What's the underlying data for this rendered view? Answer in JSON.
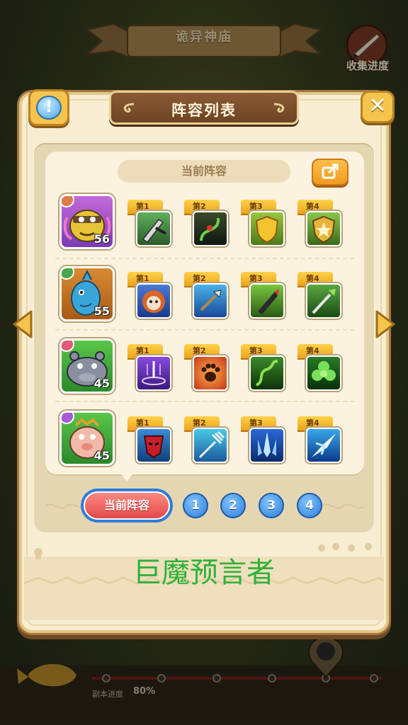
{
  "background": {
    "banner_title": "诡异神庙",
    "collection_label": "收集进度",
    "dungeon_progress_label": "副本进度",
    "dungeon_progress_value": "80%"
  },
  "dialog": {
    "title": "阵容列表",
    "current_lineup_label": "当前阵容",
    "info_symbol": "!",
    "close_symbol": "✕"
  },
  "lineup": {
    "rows": [
      {
        "hero_icon": "yellow-purple-hero-portrait",
        "level": "56",
        "slots": [
          {
            "tag": "第1",
            "icon": "blade-skill-icon"
          },
          {
            "tag": "第2",
            "icon": "dark-vine-skill-icon"
          },
          {
            "tag": "第3",
            "icon": "gold-shield-skill-icon"
          },
          {
            "tag": "第4",
            "icon": "star-shield-skill-icon"
          }
        ]
      },
      {
        "hero_icon": "blue-fish-hero-portrait",
        "level": "55",
        "slots": [
          {
            "tag": "第1",
            "icon": "lion-skill-icon"
          },
          {
            "tag": "第2",
            "icon": "spear-skill-icon"
          },
          {
            "tag": "第3",
            "icon": "drill-skill-icon"
          },
          {
            "tag": "第4",
            "icon": "green-spear-skill-icon"
          }
        ]
      },
      {
        "hero_icon": "grey-hippo-hero-portrait",
        "level": "45",
        "slots": [
          {
            "tag": "第1",
            "icon": "purple-rune-skill-icon"
          },
          {
            "tag": "第2",
            "icon": "paw-skill-icon"
          },
          {
            "tag": "第3",
            "icon": "vine-skill-icon"
          },
          {
            "tag": "第4",
            "icon": "leaf-skill-icon"
          }
        ]
      },
      {
        "hero_icon": "pink-pig-hero-portrait",
        "level": "45",
        "slots": [
          {
            "tag": "第1",
            "icon": "red-mask-skill-icon"
          },
          {
            "tag": "第2",
            "icon": "trident-skill-icon"
          },
          {
            "tag": "第3",
            "icon": "ice-spike-skill-icon"
          },
          {
            "tag": "第4",
            "icon": "ice-burst-skill-icon"
          }
        ]
      }
    ]
  },
  "tabs": {
    "current_label": "当前阵容",
    "numbers": [
      "1",
      "2",
      "3",
      "4"
    ]
  },
  "hero_name": "巨魔预言者",
  "colors": {
    "hero_name": "#2fb13a",
    "tab_active": "#e2494a",
    "tab_inactive": "#2f7cd8",
    "tag": "#eaa31c"
  }
}
